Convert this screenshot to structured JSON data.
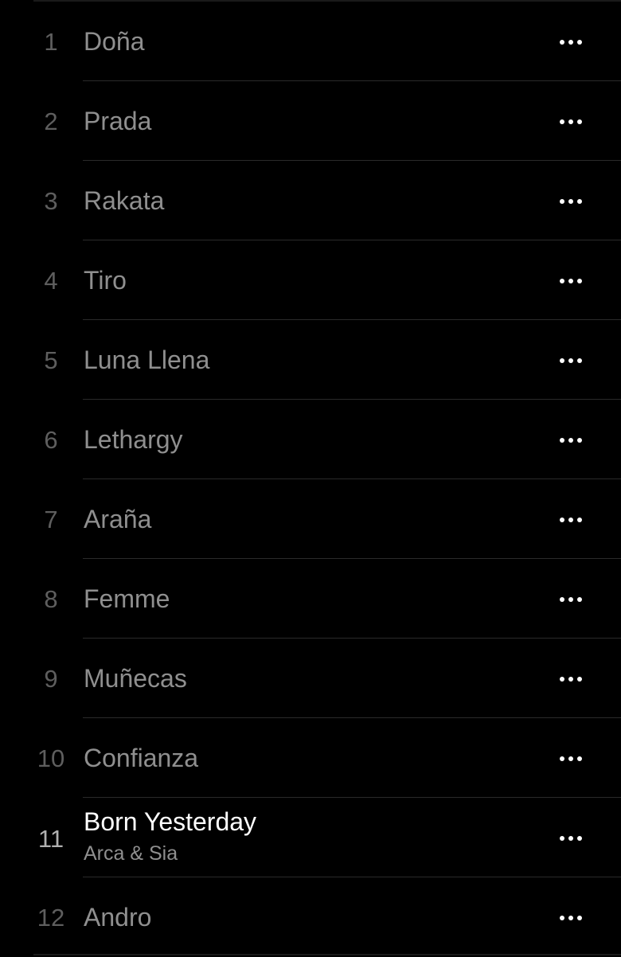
{
  "tracklist": {
    "tracks": [
      {
        "number": "1",
        "title": "Doña"
      },
      {
        "number": "2",
        "title": "Prada"
      },
      {
        "number": "3",
        "title": "Rakata"
      },
      {
        "number": "4",
        "title": "Tiro"
      },
      {
        "number": "5",
        "title": "Luna Llena"
      },
      {
        "number": "6",
        "title": "Lethargy"
      },
      {
        "number": "7",
        "title": "Araña"
      },
      {
        "number": "8",
        "title": "Femme"
      },
      {
        "number": "9",
        "title": "Muñecas"
      },
      {
        "number": "10",
        "title": "Confianza"
      },
      {
        "number": "11",
        "title": "Born Yesterday",
        "artist": "Arca & Sia",
        "active": true
      },
      {
        "number": "12",
        "title": "Andro"
      }
    ],
    "more_icon": "ellipsis-icon"
  },
  "colors": {
    "background": "#000000",
    "track_title": "#8f8f8f",
    "track_title_active": "#ffffff",
    "track_number": "#5e5e5e",
    "separator": "#2a2a2a"
  }
}
